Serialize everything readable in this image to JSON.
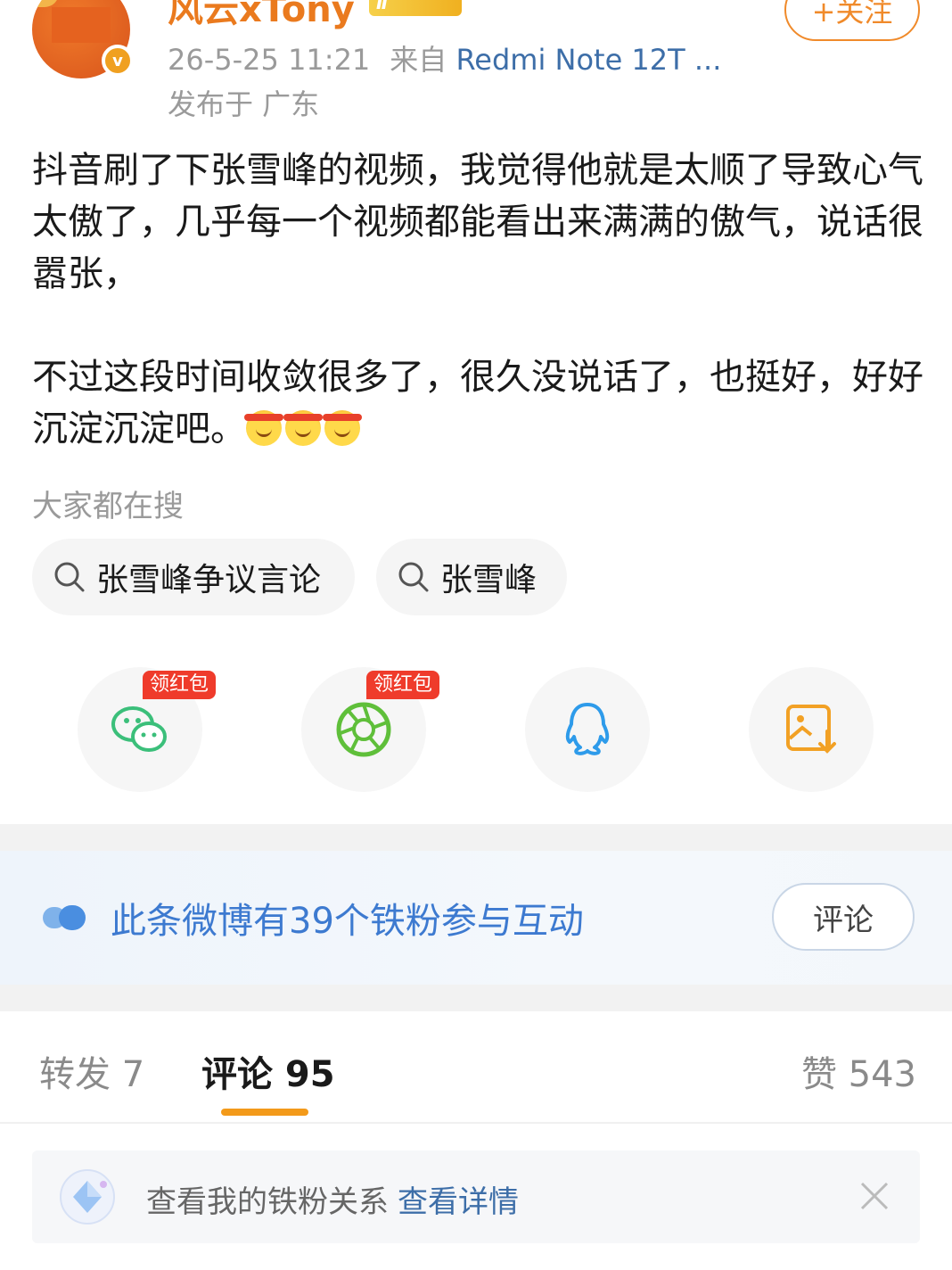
{
  "header": {
    "username": "风云xTony",
    "level_badge": "Ⅱ",
    "follow_label": "+关注",
    "timestamp": "26-5-25 11:21",
    "source_prefix": "来自",
    "device": "Redmi Note 12T ...",
    "location": "发布于 广东"
  },
  "post": {
    "paragraph1": "抖音刷了下张雪峰的视频，我觉得他就是太顺了导致心气太傲了，几乎每一个视频都能看出来满满的傲气，说话很嚣张，",
    "paragraph2": "不过这段时间收敛很多了，很久没说话了，也挺好，好好沉淀沉淀吧。"
  },
  "search": {
    "title": "大家都在搜",
    "chips": [
      "张雪峰争议言论",
      "张雪峰"
    ]
  },
  "share": {
    "red_packet_label": "领红包",
    "icons": [
      "wechat-icon",
      "moments-icon",
      "qq-icon",
      "save-image-icon"
    ]
  },
  "fans_banner": {
    "text": "此条微博有39个铁粉参与互动",
    "button": "评论"
  },
  "tabs": {
    "repost": "转发 7",
    "comment": "评论 95",
    "like": "赞 543"
  },
  "fan_relation": {
    "text": "查看我的铁粉关系",
    "link": "查看详情"
  },
  "colors": {
    "accent_orange": "#f08a2a",
    "link_blue": "#3d6ea8",
    "tab_underline": "#f39a1a"
  }
}
